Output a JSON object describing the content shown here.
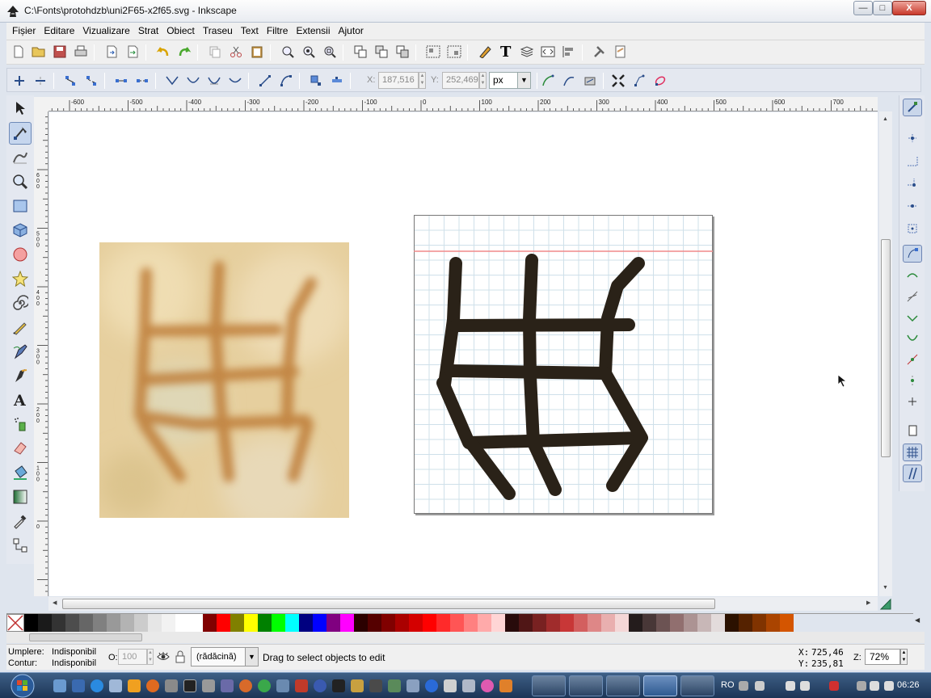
{
  "window": {
    "title": "C:\\Fonts\\protohdzb\\uni2F65-x2f65.svg - Inkscape",
    "minimize_label": "—",
    "maximize_label": "□",
    "close_label": "X"
  },
  "menu": [
    "Fișier",
    "Editare",
    "Vizualizare",
    "Strat",
    "Obiect",
    "Traseu",
    "Text",
    "Filtre",
    "Extensii",
    "Ajutor"
  ],
  "node_toolbar": {
    "x_label": "X:",
    "x_value": "187,516",
    "y_label": "Y:",
    "y_value": "252,469",
    "unit": "px"
  },
  "rulers": {
    "horizontal_ticks": [
      "-600",
      "-500",
      "-400",
      "-300",
      "-200",
      "-100",
      "0",
      "100",
      "200",
      "300",
      "400",
      "500",
      "600",
      "700"
    ],
    "vertical_ticks": [
      "600",
      "500",
      "400",
      "300",
      "200",
      "100",
      "0"
    ]
  },
  "palette": {
    "colors": [
      "#000000",
      "#1a1a1a",
      "#333333",
      "#4d4d4d",
      "#666666",
      "#808080",
      "#999999",
      "#b3b3b3",
      "#cccccc",
      "#e6e6e6",
      "#f2f2f2",
      "#ffffff",
      "#ffffff",
      "#800000",
      "#ff0000",
      "#808000",
      "#ffff00",
      "#008000",
      "#00ff00",
      "#00ffff",
      "#000080",
      "#0000ff",
      "#800080",
      "#ff00ff",
      "#2b0000",
      "#550000",
      "#800000",
      "#aa0000",
      "#d40000",
      "#ff0000",
      "#ff2a2a",
      "#ff5555",
      "#ff8080",
      "#ffaaaa",
      "#ffd5d5",
      "#280b0b",
      "#501616",
      "#782121",
      "#a02c2c",
      "#c83737",
      "#d35f5f",
      "#de8787",
      "#e9afaf",
      "#f4d7d7",
      "#241c1c",
      "#483737",
      "#6c5353",
      "#916f6f",
      "#ac9393",
      "#c8b7b7",
      "#e3dbdb",
      "#2b1100",
      "#552200",
      "#803300",
      "#aa4400",
      "#d45500"
    ]
  },
  "status": {
    "fill_label": "Umplere:",
    "fill_value": "Indisponibil",
    "stroke_label": "Contur:",
    "stroke_value": "Indisponibil",
    "opacity_label": "O:",
    "opacity_value": "100",
    "layer": "(rădăcină)",
    "message": "Drag to select objects to edit",
    "cursor_x_label": "X:",
    "cursor_x": "725,46",
    "cursor_y_label": "Y:",
    "cursor_y": "235,81",
    "zoom_label": "Z:",
    "zoom": "72%"
  },
  "taskbar": {
    "language": "RO",
    "clock": "06:26"
  },
  "theme": {
    "glyph_color": "#2a2218",
    "guide_color": "#f08a8a",
    "grid_color": "#cfe0ea"
  }
}
